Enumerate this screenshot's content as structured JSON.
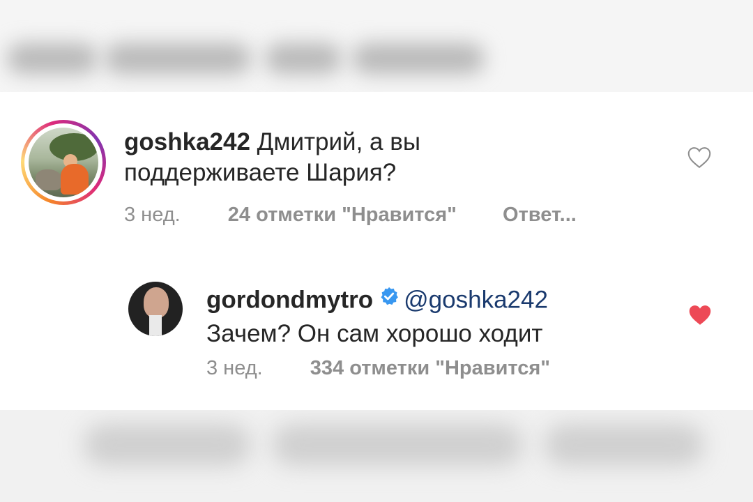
{
  "comments": [
    {
      "username": "goshka242",
      "text_line1": "Дмитрий, а вы",
      "text_line2": "поддерживаете Шария?",
      "time": "3 нед.",
      "likes": "24 отметки \"Нравится\"",
      "reply": "Ответ...",
      "liked": false
    },
    {
      "username": "gordondmytro",
      "mention": "@goshka242",
      "text": "Зачем? Он сам хорошо ходит",
      "time": "3 нед.",
      "likes": "334 отметки \"Нравится\"",
      "liked": true,
      "verified": true
    }
  ],
  "colors": {
    "heart_liked": "#ed4956",
    "verified_badge": "#3897f0",
    "meta_gray": "#8e8e8e",
    "text": "#262626"
  },
  "icons": {
    "like_empty": "heart-outline-icon",
    "like_filled": "heart-filled-icon",
    "verified": "verified-badge-icon"
  }
}
